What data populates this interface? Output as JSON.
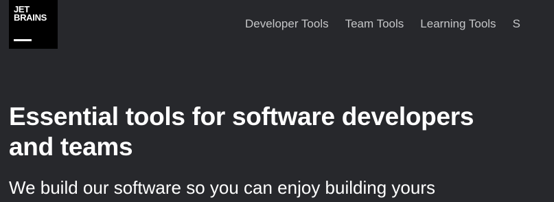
{
  "logo": {
    "text": "JET\nBRAINS",
    "background": "#000000"
  },
  "nav": {
    "items": [
      {
        "label": "Developer Tools"
      },
      {
        "label": "Team Tools"
      },
      {
        "label": "Learning Tools"
      },
      {
        "label": "S"
      }
    ]
  },
  "hero": {
    "headline_line1": "Essential tools for software developers",
    "headline_line2": "and teams",
    "subtitle": "We build our software so you can enjoy building yours"
  },
  "colors": {
    "page_background": "#27282c",
    "nav_text": "#c5c6c8",
    "headline_text": "#ffffff"
  }
}
